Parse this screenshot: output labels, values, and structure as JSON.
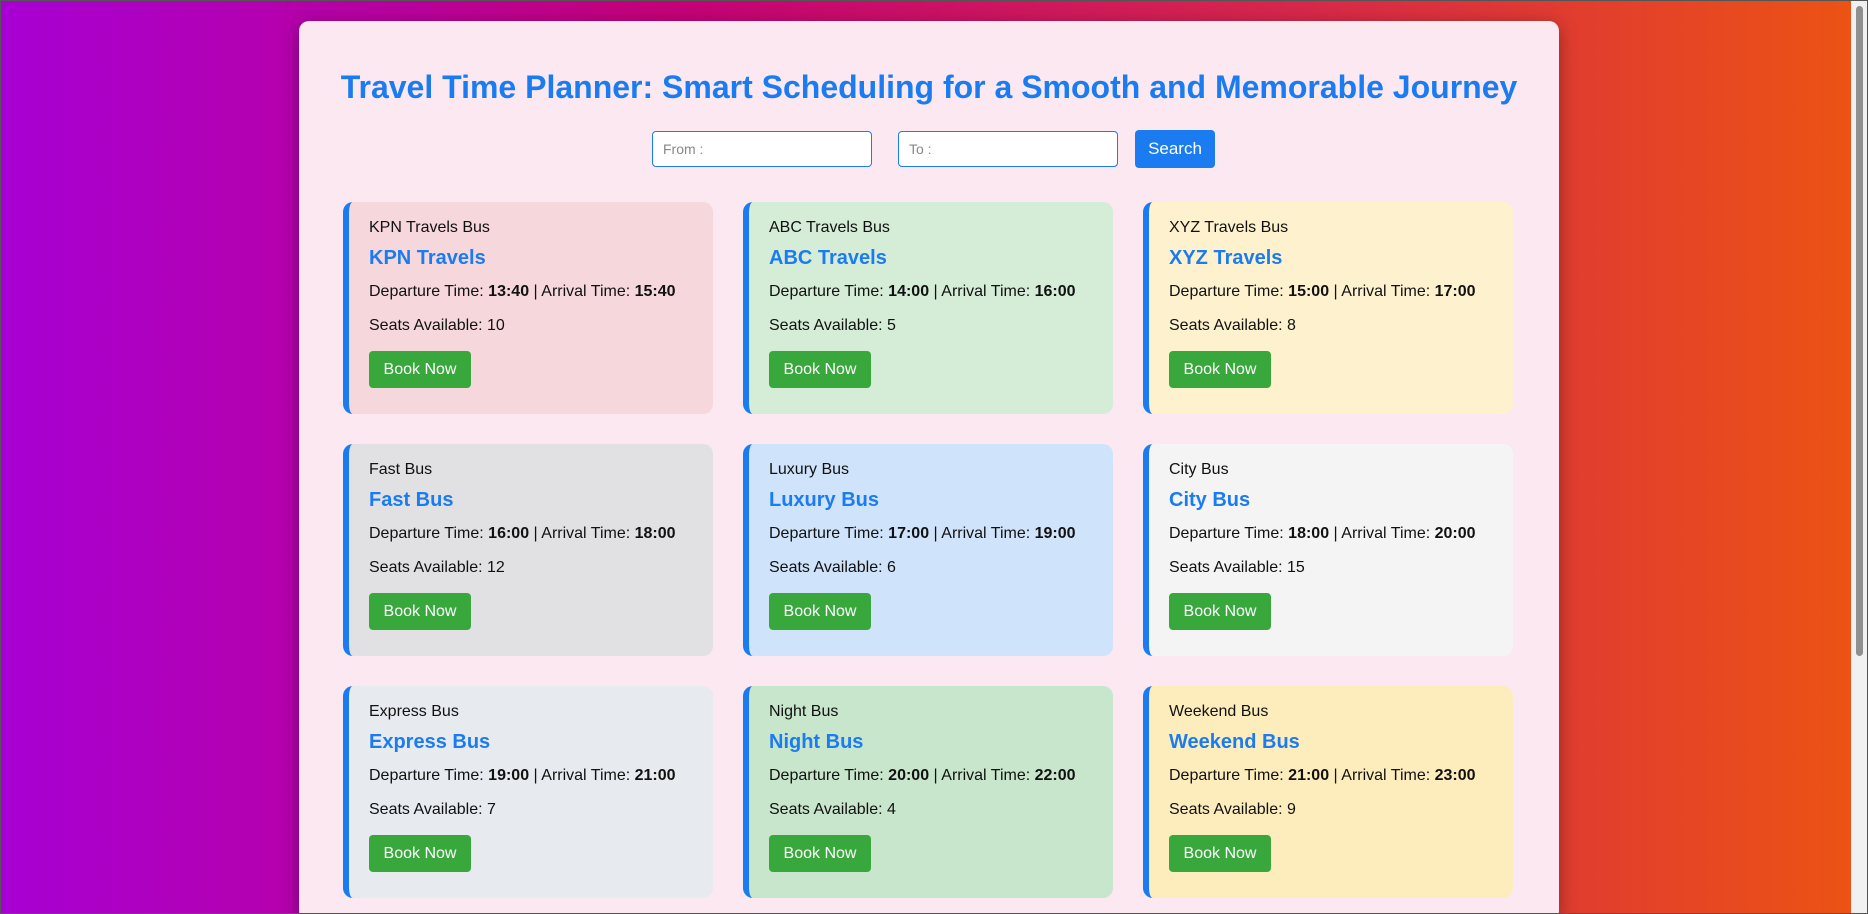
{
  "page": {
    "title": "Travel Time Planner: Smart Scheduling for a Smooth and Memorable Journey"
  },
  "search": {
    "from_placeholder": "From :",
    "to_placeholder": "To :",
    "button_label": "Search"
  },
  "labels": {
    "departure": "Departure Time:",
    "separator": "|",
    "arrival": "Arrival Time:",
    "seats": "Seats Available:",
    "book": "Book Now"
  },
  "colors": {
    "accent": "#1a7cf0",
    "book_button": "#38a83c"
  },
  "buses": [
    {
      "alt": "KPN Travels Bus",
      "name": "KPN Travels",
      "departure": "13:40",
      "arrival": "15:40",
      "seats": "10",
      "bg": "#f6d7db"
    },
    {
      "alt": "ABC Travels Bus",
      "name": "ABC Travels",
      "departure": "14:00",
      "arrival": "16:00",
      "seats": "5",
      "bg": "#d5ecd7"
    },
    {
      "alt": "XYZ Travels Bus",
      "name": "XYZ Travels",
      "departure": "15:00",
      "arrival": "17:00",
      "seats": "8",
      "bg": "#fef2ce"
    },
    {
      "alt": "Fast Bus",
      "name": "Fast Bus",
      "departure": "16:00",
      "arrival": "18:00",
      "seats": "12",
      "bg": "#e1e1e3"
    },
    {
      "alt": "Luxury Bus",
      "name": "Luxury Bus",
      "departure": "17:00",
      "arrival": "19:00",
      "seats": "6",
      "bg": "#cfe3fb"
    },
    {
      "alt": "City Bus",
      "name": "City Bus",
      "departure": "18:00",
      "arrival": "20:00",
      "seats": "15",
      "bg": "#f4f4f5"
    },
    {
      "alt": "Express Bus",
      "name": "Express Bus",
      "departure": "19:00",
      "arrival": "21:00",
      "seats": "7",
      "bg": "#e7eaee"
    },
    {
      "alt": "Night Bus",
      "name": "Night Bus",
      "departure": "20:00",
      "arrival": "22:00",
      "seats": "4",
      "bg": "#c8e6cb"
    },
    {
      "alt": "Weekend Bus",
      "name": "Weekend Bus",
      "departure": "21:00",
      "arrival": "23:00",
      "seats": "9",
      "bg": "#feedbc"
    }
  ]
}
